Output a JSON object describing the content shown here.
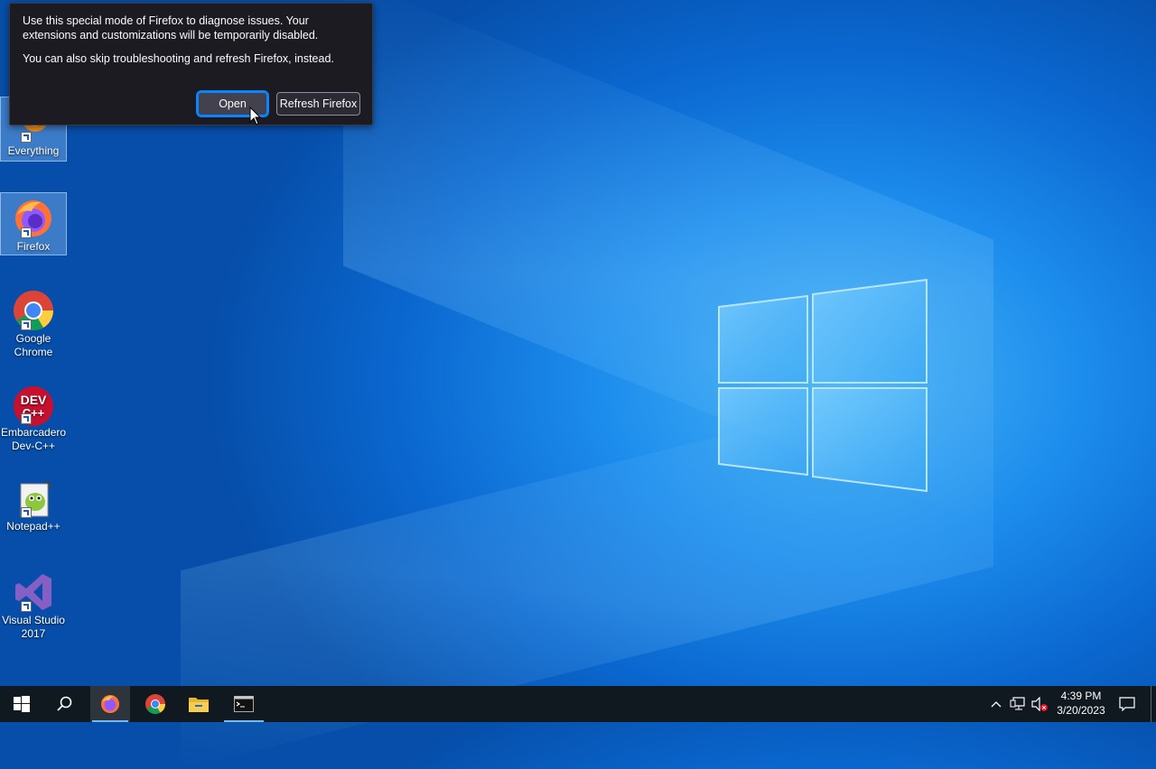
{
  "dialog": {
    "message_line1": "Use this special mode of Firefox to diagnose issues. Your extensions and customizations will be temporarily disabled.",
    "message_line2": "You can also skip troubleshooting and refresh Firefox, instead.",
    "open_label": "Open",
    "refresh_label": "Refresh Firefox"
  },
  "desktop": {
    "icons": [
      {
        "label": "Everything",
        "icon": "everything-icon"
      },
      {
        "label": "Firefox",
        "icon": "firefox-icon"
      },
      {
        "label": "Google Chrome",
        "icon": "chrome-icon"
      },
      {
        "label": "Embarcadero Dev-C++",
        "icon": "devcpp-icon"
      },
      {
        "label": "Notepad++",
        "icon": "notepadpp-icon"
      },
      {
        "label": "Visual Studio 2017",
        "icon": "visual-studio-icon"
      }
    ]
  },
  "taskbar": {
    "apps": [
      "start-icon",
      "search-icon",
      "firefox-icon",
      "chrome-icon",
      "file-explorer-icon",
      "terminal-icon"
    ],
    "tray_icons": [
      "chevron-up-icon",
      "network-icon",
      "volume-muted-icon",
      "notification-icon"
    ],
    "time": "4:39 PM",
    "date": "3/20/2023"
  },
  "colors": {
    "dialog_bg": "#1c1b22",
    "focus_ring": "#0a84ff",
    "taskbar_bg": "#101820",
    "desktop_blue": "#0a67cf"
  }
}
